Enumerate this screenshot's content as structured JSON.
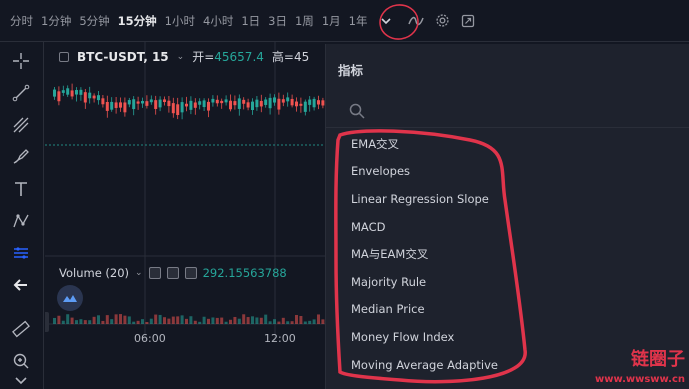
{
  "toolbar": {
    "timeframes": [
      "分时",
      "1分钟",
      "5分钟",
      "15分钟",
      "1小时",
      "4小时",
      "1日",
      "3日",
      "1周",
      "1月",
      "1年"
    ],
    "active_timeframe": "15分钟",
    "icons": [
      "chevron-down-icon",
      "indicator-wave-icon",
      "gear-icon",
      "fullscreen-icon"
    ]
  },
  "left_tools": [
    "crosshair-icon",
    "trend-line-icon",
    "fib-icon",
    "brush-icon",
    "text-icon",
    "pattern-icon",
    "measure-icon",
    "arrow-left-icon",
    "ruler-icon",
    "zoom-icon",
    "chevron-down-icon"
  ],
  "legend": {
    "symbol": "BTC-USDT, 15",
    "open_label": "开=",
    "open_value": "45657.4",
    "high_label": "高=45"
  },
  "volume": {
    "label": "Volume (20)",
    "value": "292.15563788"
  },
  "x_axis": [
    "06:00",
    "12:00"
  ],
  "panel": {
    "title": "指标",
    "search_placeholder": "",
    "items": [
      "EMA交叉",
      "Envelopes",
      "Linear Regression Slope",
      "MACD",
      "MA与EAM交叉",
      "Majority Rule",
      "Median Price",
      "Money Flow Index",
      "Moving Average Adaptive"
    ]
  },
  "watermark": {
    "text": "链圈子",
    "url": "www.wwsww.cn"
  },
  "colors": {
    "background": "#131722",
    "panel": "#1e222d",
    "up": "#26a69a",
    "down": "#ef5350",
    "annotation": "#e0344b"
  }
}
